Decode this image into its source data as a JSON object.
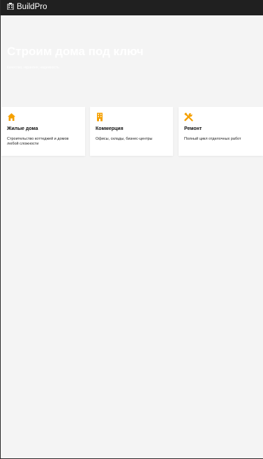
{
  "header": {
    "brand": "BuildPro",
    "brand_icon": "building-icon"
  },
  "hero": {
    "title": "Строим дома под ключ",
    "subtitle": "Качество, гарантия, надежность"
  },
  "services": [
    {
      "icon": "home-icon",
      "title": "Жилые дома",
      "description": "Строительство коттеджей и домов любой сложности"
    },
    {
      "icon": "office-building-icon",
      "title": "Коммерция",
      "description": "Офисы, склады, бизнес-центры"
    },
    {
      "icon": "tools-icon",
      "title": "Ремонт",
      "description": "Полный цикл отделочных работ"
    }
  ],
  "colors": {
    "header_bg": "#202020",
    "page_bg": "#f4f4f4",
    "accent": "#f5a000",
    "hero_text": "#ffffff"
  }
}
